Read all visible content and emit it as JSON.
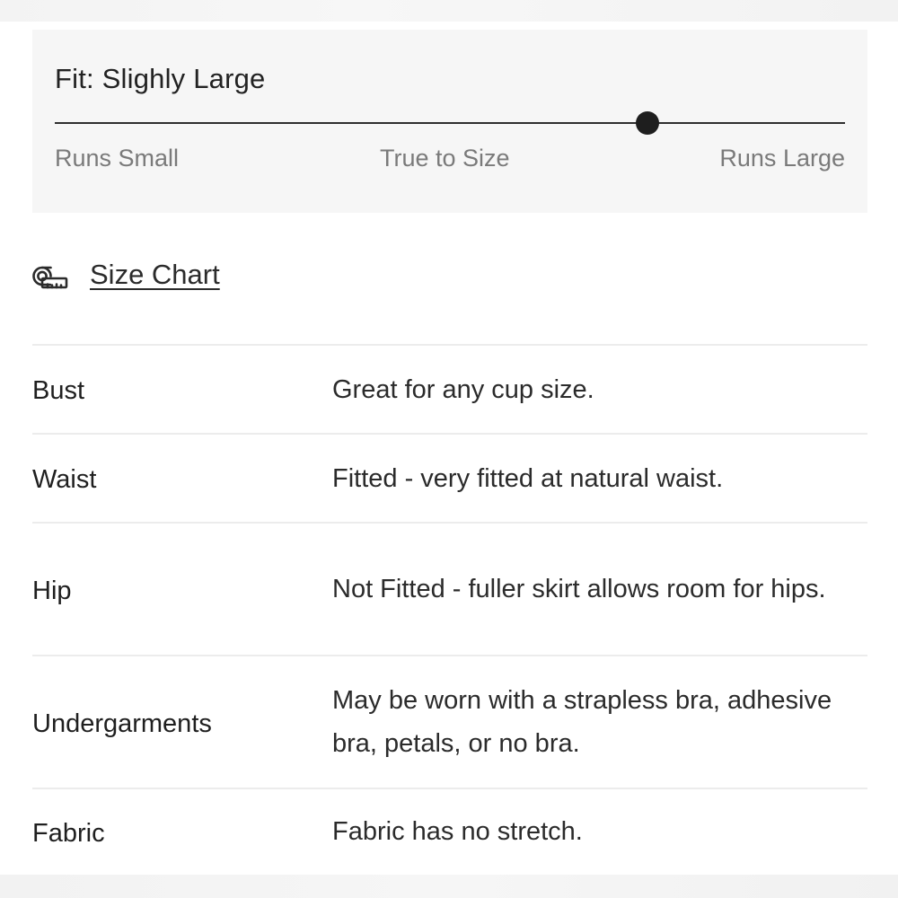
{
  "fit": {
    "title": "Fit: Slighly Large",
    "level_fraction": 0.75,
    "labels": {
      "small": "Runs Small",
      "true": "True to Size",
      "large": "Runs Large"
    }
  },
  "size_chart": {
    "icon": "measuring-tape-icon",
    "label": "Size Chart"
  },
  "fit_details": [
    {
      "attribute": "Bust",
      "description": "Great for any cup size."
    },
    {
      "attribute": "Waist",
      "description": "Fitted - very fitted at natural waist."
    },
    {
      "attribute": "Hip",
      "description": "Not Fitted - fuller skirt allows room for hips."
    },
    {
      "attribute": "Undergarments",
      "description": "May be worn with a strapless bra, adhesive bra, petals, or no bra."
    },
    {
      "attribute": "Fabric",
      "description": "Fabric has no stretch."
    }
  ]
}
